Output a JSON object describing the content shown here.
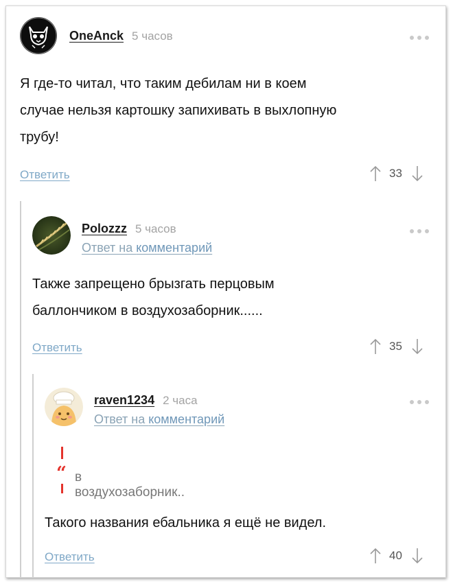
{
  "comments": [
    {
      "username": "OneAnck",
      "time": "5 часов",
      "avatar_icon": "cat-skull-icon",
      "text_lines": [
        "Я где-то читал, что таким дебилам ни в коем",
        "случае нельзя картошку запихивать в выхлопную",
        "трубу!"
      ],
      "reply_label": "Ответить",
      "score": "33"
    },
    {
      "username": "Polozzz",
      "time": "5 часов",
      "avatar_icon": "wheat-ear-icon",
      "reply_to_prefix": "Ответ на ",
      "reply_to_link": "комментарий",
      "text_lines": [
        "Также запрещено брызгать перцовым",
        "баллончиком в воздухозаборник......"
      ],
      "reply_label": "Ответить",
      "score": "35"
    },
    {
      "username": "raven1234",
      "time": "2 часа",
      "avatar_icon": "chef-cartoon-icon",
      "reply_to_prefix": "Ответ на ",
      "reply_to_link": "комментарий",
      "quote": "в воздухозаборник..",
      "text_lines": [
        "Такого названия ебальника я ещё не видел."
      ],
      "reply_label": "Ответить",
      "score": "40"
    }
  ],
  "colors": {
    "link": "#7fa8c7",
    "quote_accent": "#e4332c",
    "muted": "#a3a3a3"
  }
}
